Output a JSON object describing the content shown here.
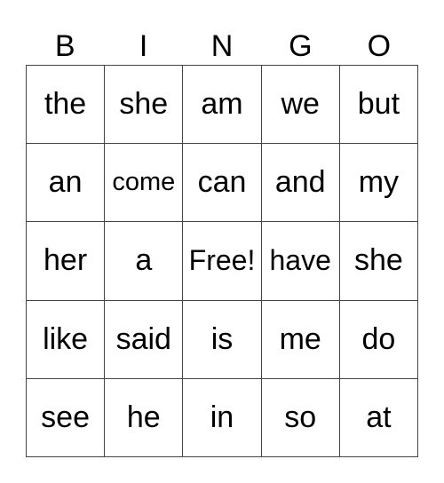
{
  "card": {
    "header": [
      "B",
      "I",
      "N",
      "G",
      "O"
    ],
    "rows": [
      [
        "the",
        "she",
        "am",
        "we",
        "but"
      ],
      [
        "an",
        "come",
        "can",
        "and",
        "my"
      ],
      [
        "her",
        "a",
        "Free!",
        "have",
        "she"
      ],
      [
        "like",
        "said",
        "is",
        "me",
        "do"
      ],
      [
        "see",
        "he",
        "in",
        "so",
        "at"
      ]
    ]
  }
}
